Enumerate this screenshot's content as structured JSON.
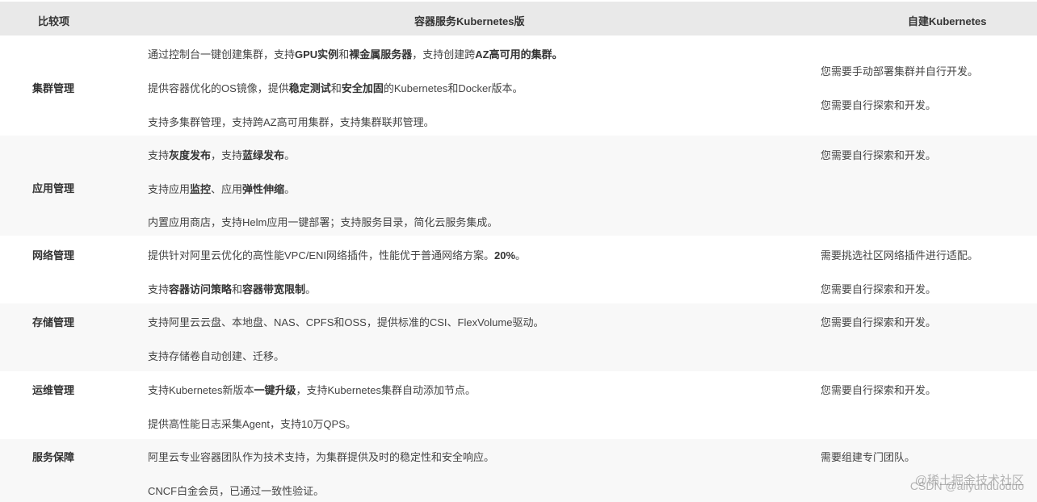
{
  "header": {
    "col1": "比较项",
    "col2": "容器服务Kubernetes版",
    "col3": "自建Kubernetes"
  },
  "rows": [
    {
      "name": "集群管理",
      "left": [
        [
          {
            "t": "通过控制台一键创建集群，支持"
          },
          {
            "t": "GPU实例",
            "b": true
          },
          {
            "t": "和"
          },
          {
            "t": "裸金属服务器",
            "b": true
          },
          {
            "t": "，支持创建跨"
          },
          {
            "t": "AZ高可用的集群。",
            "b": true
          }
        ],
        [
          {
            "t": "提供容器优化的OS镜像，提供"
          },
          {
            "t": "稳定测试",
            "b": true
          },
          {
            "t": "和"
          },
          {
            "t": "安全加固",
            "b": true
          },
          {
            "t": "的Kubernetes和Docker版本。"
          }
        ],
        [
          {
            "t": "支持多集群管理，支持跨AZ高可用集群，支持集群联邦管理。"
          }
        ]
      ],
      "right": [
        "您需要手动部署集群并自行开发。",
        "您需要自行探索和开发。"
      ]
    },
    {
      "name": "应用管理",
      "left": [
        [
          {
            "t": "支持"
          },
          {
            "t": "灰度发布",
            "b": true
          },
          {
            "t": "，支持"
          },
          {
            "t": "蓝绿发布",
            "b": true
          },
          {
            "t": "。"
          }
        ],
        [
          {
            "t": "支持应用"
          },
          {
            "t": "监控",
            "b": true
          },
          {
            "t": "、应用"
          },
          {
            "t": "弹性伸缩",
            "b": true
          },
          {
            "t": "。"
          }
        ],
        [
          {
            "t": "内置应用商店，支持Helm应用一键部署；支持服务目录，简化云服务集成。"
          }
        ]
      ],
      "right": [
        "您需要自行探索和开发。"
      ]
    },
    {
      "name": "网络管理",
      "left": [
        [
          {
            "t": "提供针对阿里云优化的高性能VPC/ENI网络插件，性能优于普通网络方案。"
          },
          {
            "t": "20%",
            "b": true
          },
          {
            "t": "。"
          }
        ],
        [
          {
            "t": "支持"
          },
          {
            "t": "容器访问策略",
            "b": true
          },
          {
            "t": "和"
          },
          {
            "t": "容器带宽限制",
            "b": true
          },
          {
            "t": "。"
          }
        ]
      ],
      "right": [
        "需要挑选社区网络插件进行适配。",
        "您需要自行探索和开发。"
      ]
    },
    {
      "name": "存储管理",
      "left": [
        [
          {
            "t": "支持阿里云云盘、本地盘、NAS、CPFS和OSS，提供标准的CSI、FlexVolume驱动。"
          }
        ],
        [
          {
            "t": "支持存储卷自动创建、迁移。"
          }
        ]
      ],
      "right": [
        "您需要自行探索和开发。"
      ]
    },
    {
      "name": "运维管理",
      "left": [
        [
          {
            "t": "支持Kubernetes新版本"
          },
          {
            "t": "一键升级",
            "b": true
          },
          {
            "t": "，支持Kubernetes集群自动添加节点。"
          }
        ],
        [
          {
            "t": "提供高性能日志采集Agent，支持10万QPS。"
          }
        ]
      ],
      "right": [
        "您需要自行探索和开发。"
      ]
    },
    {
      "name": "服务保障",
      "left": [
        [
          {
            "t": "阿里云专业容器团队作为技术支持，为集群提供及时的稳定性和安全响应。"
          }
        ],
        [
          {
            "t": "CNCF白金会员，已通过一致性验证。"
          }
        ]
      ],
      "right": [
        "需要组建专门团队。"
      ]
    }
  ],
  "watermarks": [
    "@稀土掘金技术社区",
    "CSDN @aliyunduoduo"
  ]
}
